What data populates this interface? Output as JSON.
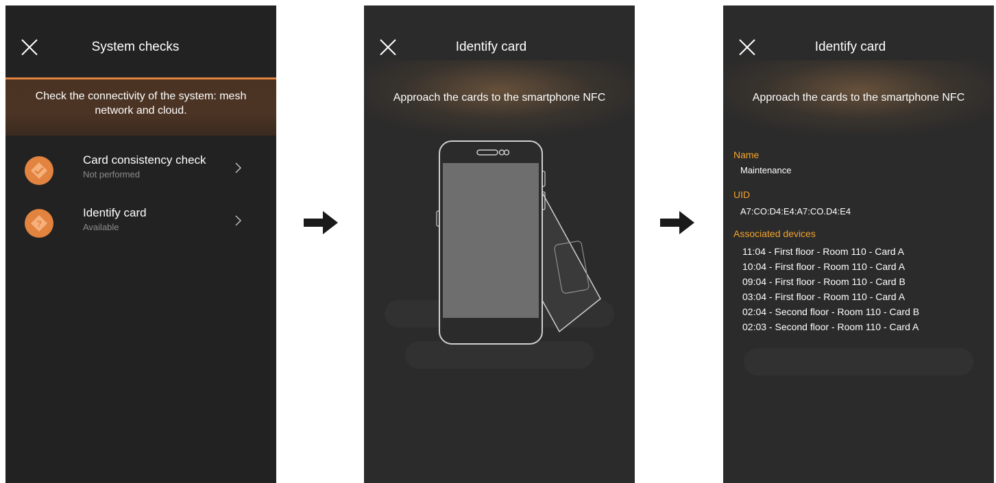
{
  "screen1": {
    "title": "System checks",
    "banner_text": "Check the connectivity of the system: mesh network and cloud.",
    "items": [
      {
        "label": "Card consistency check",
        "status": "Not performed",
        "icon": "check-badge-icon"
      },
      {
        "label": "Identify card",
        "status": "Available",
        "icon": "question-badge-icon"
      }
    ]
  },
  "screen2": {
    "title": "Identify card",
    "instruction": "Approach the cards to the smartphone NFC"
  },
  "screen3": {
    "title": "Identify card",
    "instruction": "Approach the cards to the smartphone NFC",
    "name_label": "Name",
    "name_value": "Maintenance",
    "uid_label": "UID",
    "uid_value": "A7:CO:D4:E4:A7:CO.D4:E4",
    "devices_label": "Associated devices",
    "devices": [
      "11:04 - First floor - Room 110 - Card A",
      "10:04 - First floor - Room 110 - Card A",
      "09:04 - First floor - Room 110 - Card B",
      "03:04 - First floor - Room 110 - Card A",
      "02:04 - Second floor - Room 110 - Card B",
      "02:03 - Second floor - Room 110 - Card A"
    ]
  },
  "colors": {
    "accent": "#e2833f",
    "label_accent": "#f4a42e",
    "screen_bg": "#2b2b2b"
  }
}
